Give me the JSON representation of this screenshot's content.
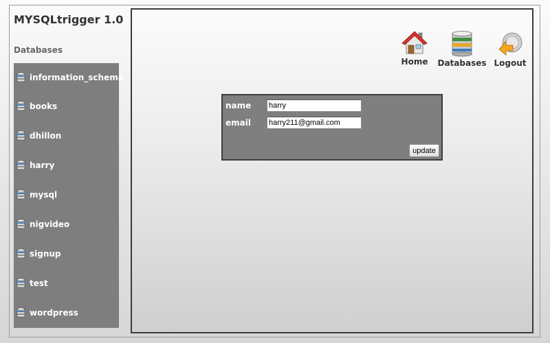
{
  "app": {
    "title": "MYSQLtrigger 1.0"
  },
  "sidebar": {
    "heading": "Databases",
    "items": [
      {
        "label": "information_schema",
        "icon": "database-icon"
      },
      {
        "label": "books",
        "icon": "database-icon"
      },
      {
        "label": "dhillon",
        "icon": "database-icon"
      },
      {
        "label": "harry",
        "icon": "database-icon"
      },
      {
        "label": "mysql",
        "icon": "database-icon"
      },
      {
        "label": "nigvideo",
        "icon": "database-icon"
      },
      {
        "label": "signup",
        "icon": "database-icon"
      },
      {
        "label": "test",
        "icon": "database-icon"
      },
      {
        "label": "wordpress",
        "icon": "database-icon"
      }
    ]
  },
  "nav": {
    "home": {
      "label": "Home",
      "icon": "home-icon"
    },
    "databases": {
      "label": "Databases",
      "icon": "databases-icon"
    },
    "logout": {
      "label": "Logout",
      "icon": "logout-icon"
    }
  },
  "form": {
    "name_label": "name",
    "name_value": "harry",
    "email_label": "email",
    "email_value": "harry211@gmail.com",
    "update_label": "update"
  },
  "colors": {
    "sidebar_bg": "#7e7e7e",
    "form_bg": "#7f7f7f",
    "panel_border": "#3a3a3a"
  }
}
